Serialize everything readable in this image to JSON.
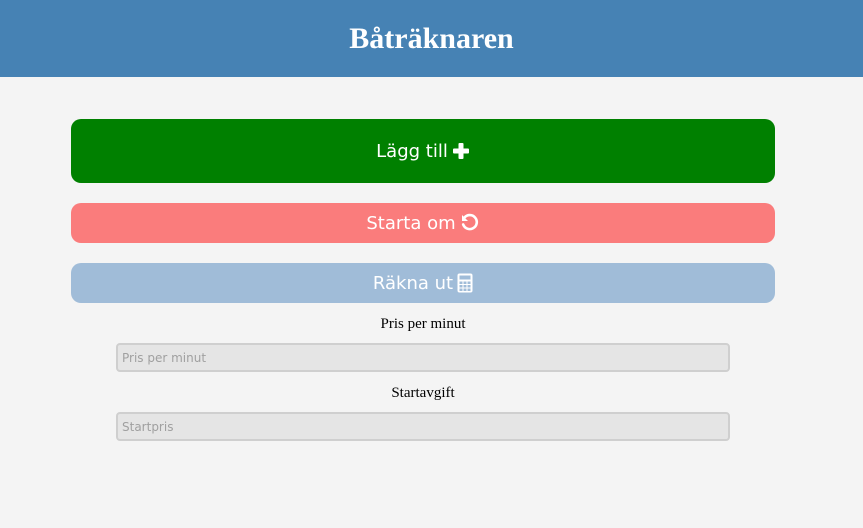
{
  "header": {
    "title": "Båträknaren"
  },
  "buttons": {
    "add_label": "Lägg till",
    "add_icon": "plus-icon",
    "restart_label": "Starta om",
    "restart_icon": "undo-icon",
    "calc_label": "Räkna ut",
    "calc_icon": "calculator-icon"
  },
  "fields": {
    "price_per_minute": {
      "label": "Pris per minut",
      "placeholder": "Pris per minut",
      "value": ""
    },
    "start_fee": {
      "label": "Startavgift",
      "placeholder": "Startpris",
      "value": ""
    }
  },
  "colors": {
    "header_bg": "#4682b4",
    "page_bg": "#f4f4f4",
    "add_button": "#008000",
    "restart_button": "#fa7c7c",
    "calc_button": "#a0bcd8"
  }
}
